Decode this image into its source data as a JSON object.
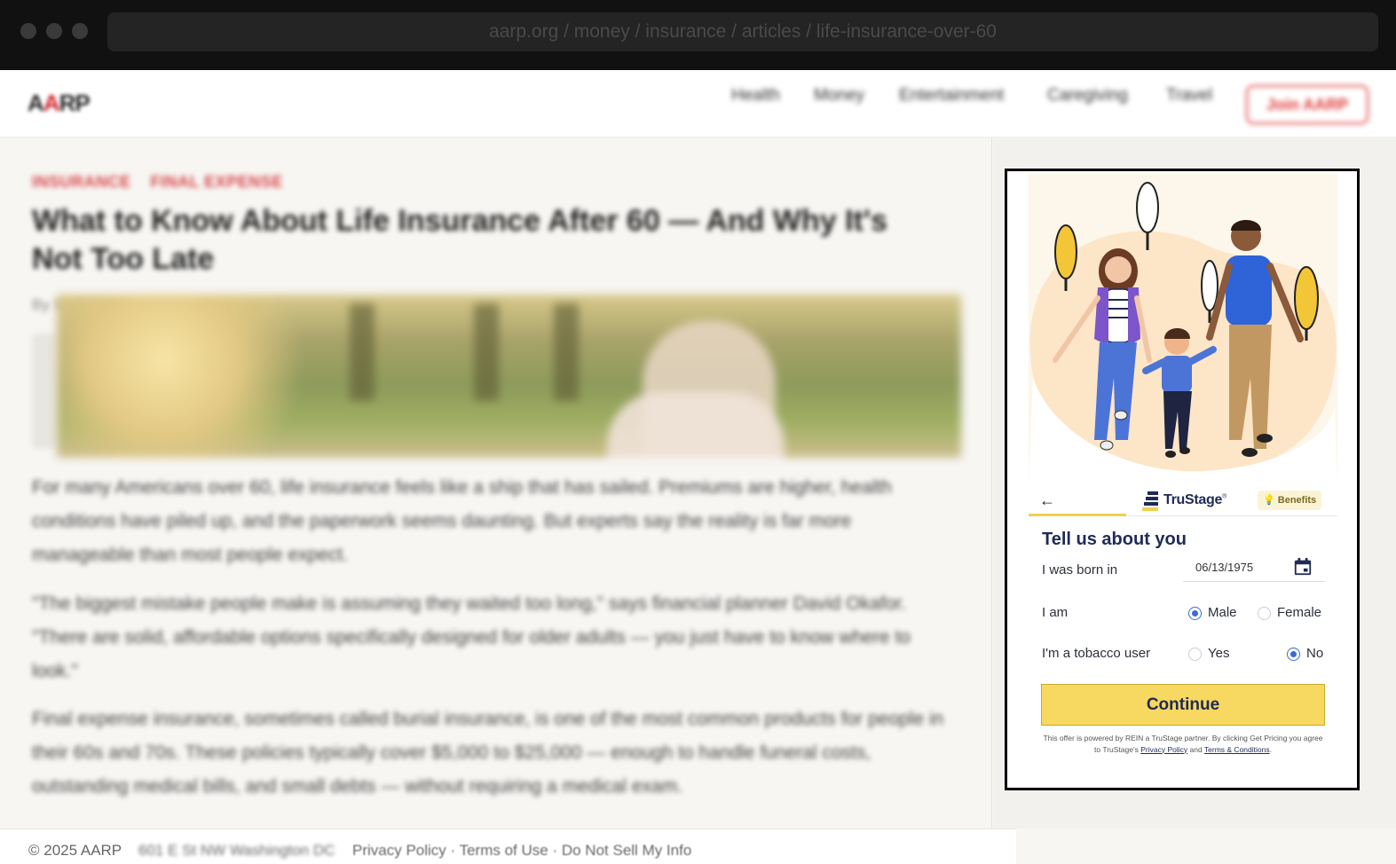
{
  "browser": {
    "url": "aarp.org / money / insurance / articles / life-insurance-over-60"
  },
  "site": {
    "logo": {
      "a": "A",
      "a2": "A",
      "rp": "RP"
    },
    "nav": [
      "Health",
      "Money",
      "Entertainment",
      "Caregiving",
      "Travel"
    ],
    "join_label": "Join AARP"
  },
  "article": {
    "kicker": [
      "INSURANCE",
      "FINAL EXPENSE"
    ],
    "title": "What to Know About Life Insurance After 60 — And Why It's Not Too Late",
    "byline": "By Staff Writer",
    "paragraphs": [
      "For many Americans over 60, life insurance feels like a ship that has sailed. Premiums are higher, health conditions have piled up, and the paperwork seems daunting. But experts say the reality is far more manageable than most people expect.",
      "\"The biggest mistake people make is assuming they waited too long,\" says financial planner David Okafor. \"There are solid, affordable options specifically designed for older adults — you just have to know where to look.\"",
      "Final expense insurance, sometimes called burial insurance, is one of the most common products for people in their 60s and 70s. These policies typically cover $5,000 to $25,000 — enough to handle funeral costs, outstanding medical bills, and small debts — without requiring a medical exam."
    ]
  },
  "footer": {
    "copyright": "© 2025 AARP",
    "address": "601 E St NW Washington DC",
    "links": "Privacy Policy · Terms of Use · Do Not Sell My Info"
  },
  "ad": {
    "brand_name": "TruStage",
    "brand_tm": "®",
    "benefits_label": "Benefits",
    "form_title": "Tell us about you",
    "born_label": "I was born in",
    "birth_date": "06/13/1975",
    "gender_label": "I am",
    "gender_options": [
      "Male",
      "Female"
    ],
    "gender_selected": "Male",
    "tobacco_label": "I'm a tobacco user",
    "tobacco_options": [
      "Yes",
      "No"
    ],
    "tobacco_selected": "No",
    "continue_label": "Continue",
    "disclaimer_text": "This offer is powered by REIN a TruStage partner. By clicking Get Pricing you agree to TruStage's",
    "privacy_link": "Privacy Policy",
    "and_text": "and",
    "terms_link": "Terms & Conditions",
    "period": ".",
    "colors": {
      "accent": "#f7d860",
      "navy": "#1f2a56",
      "radio": "#3a6bd6"
    }
  }
}
